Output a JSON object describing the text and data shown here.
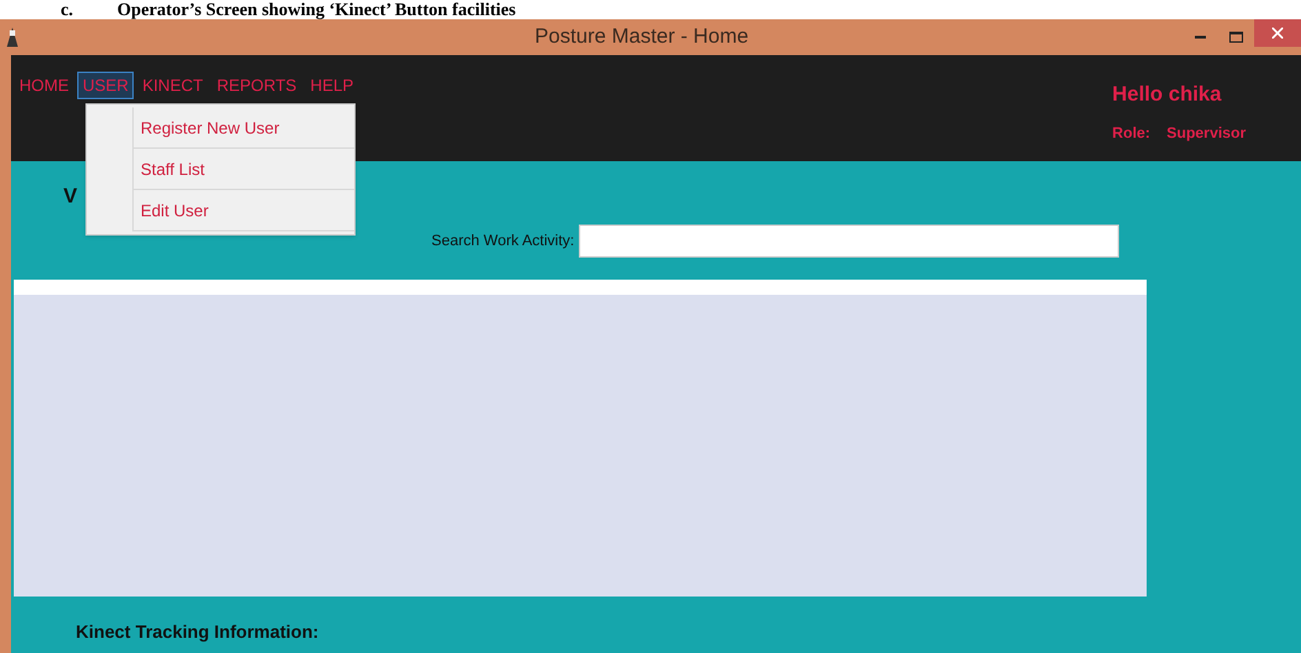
{
  "caption": {
    "label": "c.",
    "text": "Operator’s Screen showing ‘Kinect’ Button facilities"
  },
  "window": {
    "title": "Posture Master - Home"
  },
  "menu": [
    {
      "label": "HOME",
      "selected": false
    },
    {
      "label": "USER",
      "selected": true
    },
    {
      "label": "KINECT",
      "selected": false
    },
    {
      "label": "REPORTS",
      "selected": false
    },
    {
      "label": "HELP",
      "selected": false
    }
  ],
  "dropdown": {
    "items": [
      "Register New User",
      "Staff List",
      "Edit User"
    ]
  },
  "user": {
    "greeting": "Hello chika",
    "role_label": "Role:",
    "role": "Supervisor"
  },
  "heading": "V",
  "search": {
    "label": "Search Work Activity:"
  },
  "footer_label": "Kinect Tracking Information:"
}
